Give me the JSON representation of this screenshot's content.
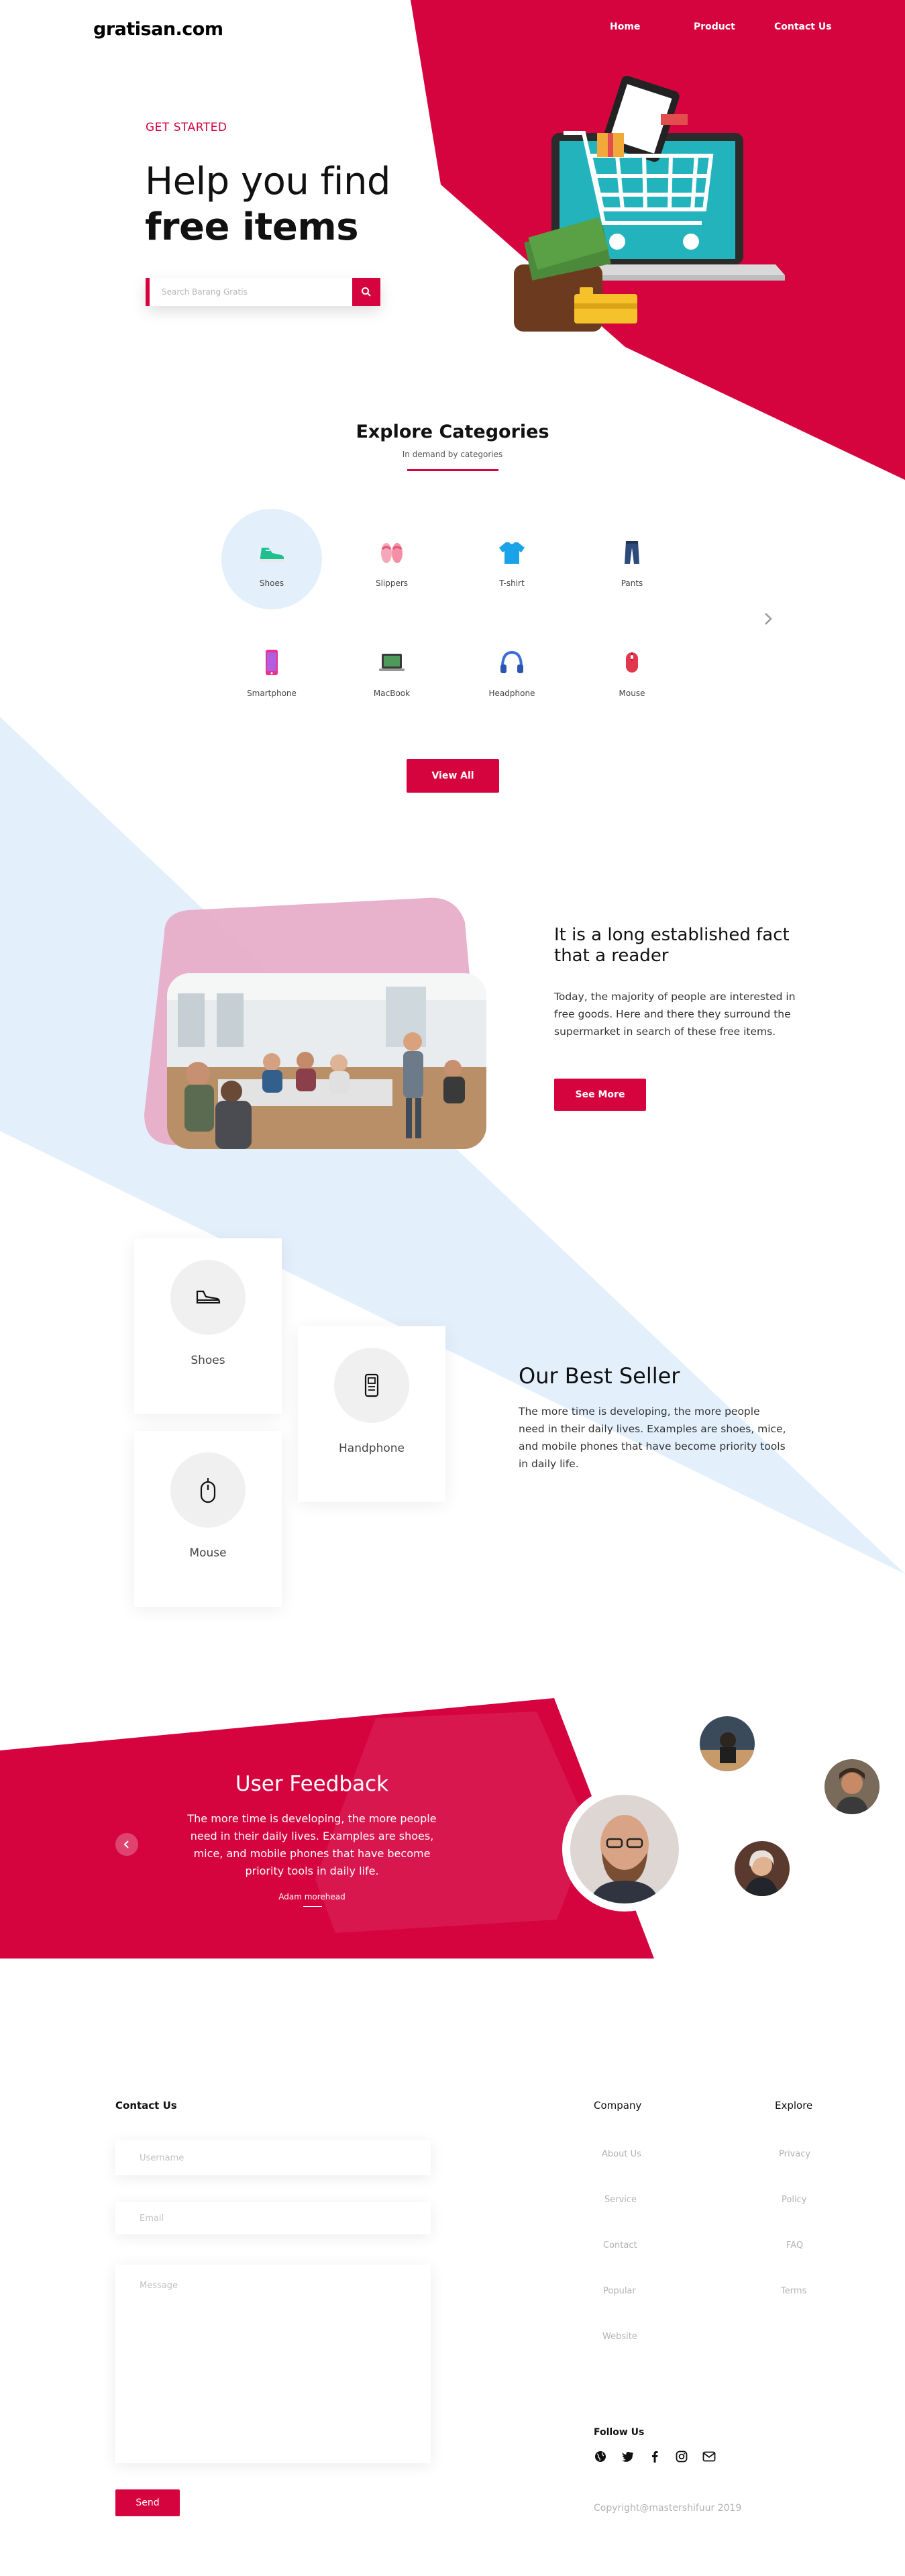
{
  "brand": {
    "logo": "gratisan.com",
    "accent": "#d5043f",
    "light_blue": "#e3f0fc"
  },
  "nav": {
    "items": [
      "Home",
      "Product",
      "Contact Us"
    ]
  },
  "hero": {
    "eyebrow": "GET STARTED",
    "title_line1": "Help you find",
    "title_line2": "free items",
    "search_placeholder": "Search Barang Gratis",
    "search_icon": "search-icon",
    "illustration": "laptop-shopping-cart-wallet-illustration"
  },
  "categories": {
    "title": "Explore Categories",
    "subtitle": "In demand by categories",
    "items": [
      {
        "label": "Shoes",
        "icon": "sneaker-icon",
        "active": true
      },
      {
        "label": "Slippers",
        "icon": "slippers-icon",
        "active": false
      },
      {
        "label": "T-shirt",
        "icon": "tshirt-icon",
        "active": false
      },
      {
        "label": "Pants",
        "icon": "pants-icon",
        "active": false
      },
      {
        "label": "Smartphone",
        "icon": "smartphone-icon",
        "active": false
      },
      {
        "label": "MacBook",
        "icon": "laptop-icon",
        "active": false
      },
      {
        "label": "Headphone",
        "icon": "headphone-icon",
        "active": false
      },
      {
        "label": "Mouse",
        "icon": "mouse-icon",
        "active": false
      }
    ],
    "next_icon": "chevron-right-icon",
    "view_all": "View All"
  },
  "about": {
    "title": "It is a long established fact that a reader",
    "text": "Today, the majority of people are interested in free goods. Here and there they surround the supermarket in search of these free items.",
    "button": "See More",
    "image": "classroom-photo"
  },
  "best_seller": {
    "title": "Our Best Seller",
    "text": "The more time is developing, the more people need in their daily lives. Examples are shoes, mice, and mobile phones that have become priority tools in daily life.",
    "cards": [
      {
        "label": "Shoes",
        "icon": "shoe-outline-icon"
      },
      {
        "label": "Handphone",
        "icon": "phone-outline-icon"
      },
      {
        "label": "Mouse",
        "icon": "mouse-outline-icon"
      }
    ]
  },
  "feedback": {
    "title": "User Feedback",
    "text": "The more time is developing, the more people need in their daily lives. Examples are shoes, mice, and mobile phones that have become priority tools in daily life.",
    "author": "Adam morehead",
    "prev_icon": "chevron-left-icon"
  },
  "footer": {
    "contact_title": "Contact Us",
    "username_placeholder": "Username",
    "email_placeholder": "Email",
    "message_placeholder": "Message",
    "send": "Send",
    "company_title": "Company",
    "company_links": [
      "About Us",
      "Service",
      "Contact",
      "Popular",
      "Website"
    ],
    "explore_title": "Explore",
    "explore_links": [
      "Privacy",
      "Policy",
      "FAQ",
      "Terms"
    ],
    "follow_title": "Follow Us",
    "social_icons": [
      "globe-icon",
      "twitter-icon",
      "facebook-icon",
      "instagram-icon",
      "mail-icon"
    ],
    "copyright": "Copyright@mastershifuur 2019"
  }
}
